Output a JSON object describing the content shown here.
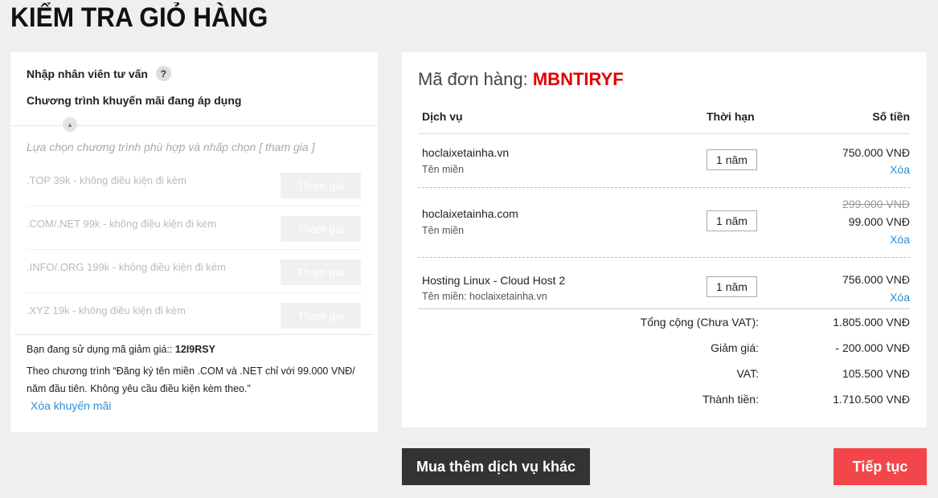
{
  "page": {
    "title": "KIỂM TRA GIỎ HÀNG"
  },
  "promo_panel": {
    "consultant_label": "Nhập nhân viên tư vấn",
    "help_symbol": "?",
    "heading": "Chương trình khuyến mãi đang áp dụng",
    "hint": "Lựa chọn chương trình phù hợp và nhấp chọn [ tham gia ]",
    "join_label": "Tham gia",
    "programs": [
      {
        "label": ".TOP 39k - không điều kiện đi kèm"
      },
      {
        "label": ".COM/.NET 99k - không điều kiện đi kèm"
      },
      {
        "label": ".INFO/.ORG 199k - không điều kiện đi kèm"
      },
      {
        "label": ".XYZ 19k - không điều kiện đi kèm"
      }
    ],
    "coupon_prefix": "Bạn đang sử dụng mã giảm giá:: ",
    "coupon_code": "12I9RSY",
    "coupon_description": "Theo chương trình “Đăng ký tên miền .COM và .NET chỉ với 99.000 VNĐ/ năm đầu tiên. Không yêu cầu điều kiện kèm theo.”",
    "remove_promo_label": "Xóa khuyến mãi"
  },
  "order": {
    "title_prefix": "Mã đơn hàng: ",
    "code": "MBNTIRYF",
    "headers": {
      "service": "Dịch vụ",
      "duration": "Thời hạn",
      "amount": "Số tiền"
    },
    "remove_label": "Xóa",
    "items": [
      {
        "name": "hoclaixetainha.vn",
        "sub": "Tên miền",
        "duration": "1 năm",
        "old_price": "",
        "price": "750.000 VNĐ"
      },
      {
        "name": "hoclaixetainha.com",
        "sub": "Tên miền",
        "duration": "1 năm",
        "old_price": "299.000 VNĐ",
        "price": "99.000 VNĐ"
      },
      {
        "name": "Hosting Linux - Cloud Host 2",
        "sub": "Tên miền: hoclaixetainha.vn",
        "duration": "1 năm",
        "old_price": "",
        "price": "756.000 VNĐ"
      }
    ],
    "summary": [
      {
        "label": "Tổng cộng (Chưa VAT):",
        "value": "1.805.000 VNĐ"
      },
      {
        "label": "Giảm giá:",
        "value": "- 200.000 VNĐ"
      },
      {
        "label": "VAT:",
        "value": "105.500 VNĐ"
      },
      {
        "label": "Thành tiền:",
        "value": "1.710.500 VNĐ"
      }
    ]
  },
  "actions": {
    "more_services": "Mua thêm dịch vụ khác",
    "continue": "Tiếp tục"
  },
  "colors": {
    "accent_red": "#e00000",
    "button_red": "#f2464a",
    "link_blue": "#2d8fd5",
    "dark_button": "#333333"
  }
}
